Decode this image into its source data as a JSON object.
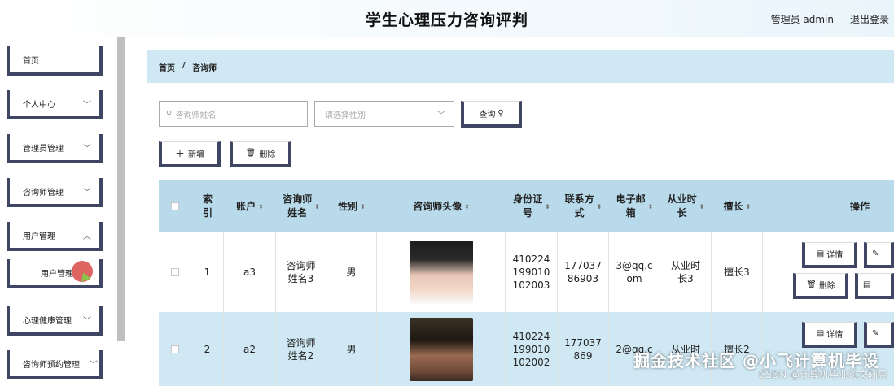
{
  "header": {
    "title": "学生心理压力咨询评判",
    "admin": "管理员 admin",
    "logout": "退出登录"
  },
  "sidebar": {
    "items": [
      {
        "label": "首页",
        "chevron": ""
      },
      {
        "label": "个人中心",
        "chevron": "﹀"
      },
      {
        "label": "管理员管理",
        "chevron": "﹀"
      },
      {
        "label": "咨询师管理",
        "chevron": "﹀"
      },
      {
        "label": "用户管理",
        "chevron": "︿"
      },
      {
        "label": "用户管理",
        "chevron": ""
      },
      {
        "label": "心理健康管理",
        "chevron": "﹀"
      },
      {
        "label": "咨询师预约管理",
        "chevron": "﹀"
      }
    ]
  },
  "breadcrumb": {
    "home": "首页",
    "sep": "/",
    "current": "咨询师"
  },
  "search": {
    "placeholder": "咨询师姓名",
    "gender_placeholder": "请选择性别",
    "query_label": "查询"
  },
  "actions": {
    "add_label": "新增",
    "delete_label": "删除"
  },
  "table": {
    "headers": {
      "index": "索\n引",
      "account": "账户",
      "name": "咨询师\n姓名",
      "gender": "性别",
      "photo": "咨询师头像",
      "idcard": "身份证\n号",
      "phone": "联系方\n式",
      "email": "电子邮\n箱",
      "years": "从业时\n长",
      "skill": "擅长",
      "ops": "操作"
    },
    "rows": [
      {
        "index": "1",
        "account": "a3",
        "name": "咨询师\n姓名3",
        "gender": "男",
        "idcard": "410224\n199010\n102003",
        "phone": "177037\n86903",
        "email": "3@qq.c\nom",
        "years": "从业时\n长3",
        "skill": "擅长3"
      },
      {
        "index": "2",
        "account": "a2",
        "name": "咨询师\n姓名2",
        "gender": "男",
        "idcard": "410224\n199010\n102002",
        "phone": "177037\n869",
        "email": "2@qq.c",
        "years": "从业时",
        "skill": "擅长2"
      }
    ],
    "row_actions": {
      "detail": "详情",
      "delete": "删除"
    }
  },
  "watermark": {
    "text": "掘金技术社区 @小飞计算机毕设",
    "sub": "CSDN @计算机毕业论文辅导"
  }
}
